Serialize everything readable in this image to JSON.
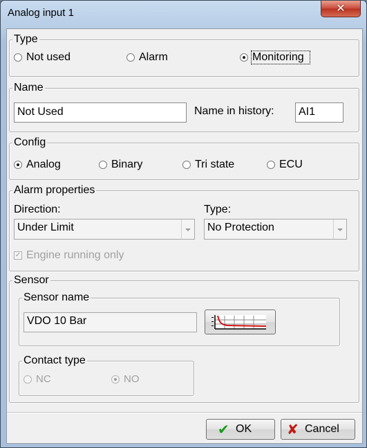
{
  "window": {
    "title": "Analog input 1",
    "close_glyph": "✕"
  },
  "type_group": {
    "legend": "Type",
    "options": [
      {
        "label": "Not used",
        "checked": false
      },
      {
        "label": "Alarm",
        "checked": false
      },
      {
        "label": "Monitoring",
        "checked": true
      }
    ]
  },
  "name_group": {
    "legend": "Name",
    "name_value": "Not Used",
    "history_label": "Name in history:",
    "history_value": "AI1"
  },
  "config_group": {
    "legend": "Config",
    "options": [
      {
        "label": "Analog",
        "checked": true
      },
      {
        "label": "Binary",
        "checked": false
      },
      {
        "label": "Tri state",
        "checked": false
      },
      {
        "label": "ECU",
        "checked": false
      }
    ]
  },
  "alarm_group": {
    "legend": "Alarm properties",
    "direction_label": "Direction:",
    "direction_value": "Under Limit",
    "type_label": "Type:",
    "type_value": "No Protection",
    "engine_running_label": "Engine running only",
    "engine_running_checked": true
  },
  "sensor_group": {
    "legend": "Sensor",
    "sensor_name_legend": "Sensor name",
    "sensor_name_value": "VDO 10 Bar",
    "curve_button_icon": "sensor-curve-icon",
    "contact_type_legend": "Contact type",
    "contact_options": [
      {
        "label": "NC",
        "checked": false
      },
      {
        "label": "NO",
        "checked": true
      }
    ]
  },
  "buttons": {
    "ok_label": "OK",
    "cancel_label": "Cancel"
  },
  "colors": {
    "ok_check": "#1a9a1a",
    "cancel_x": "#c01a10",
    "curve_red": "#d01010",
    "close_button": "#c9493a"
  }
}
